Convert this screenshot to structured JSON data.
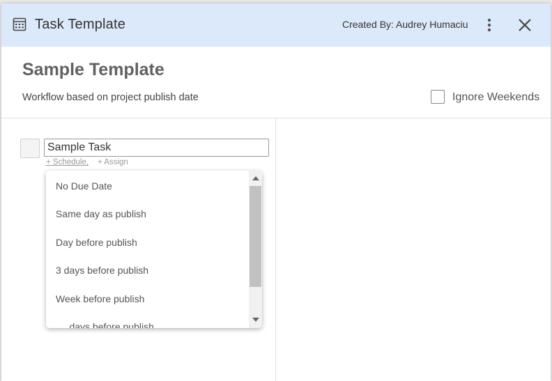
{
  "header": {
    "title": "Task Template",
    "created_by": "Created By: Audrey Humaciu",
    "icons": [
      "template-icon",
      "more-vertical-icon",
      "close-icon"
    ],
    "background": "#dce9fb"
  },
  "template": {
    "name": "Sample Template",
    "description": "Workflow based on project publish date",
    "ignore_weekends_label": "Ignore Weekends",
    "ignore_weekends_checked": false
  },
  "task": {
    "name_value": "Sample Task",
    "schedule_link": "+ Schedule,",
    "assign_link": "+ Assign"
  },
  "schedule_dropdown": {
    "options": [
      "No Due Date",
      "Same day as publish",
      "Day before publish",
      "3 days before publish",
      "Week before publish",
      "__ days before publish"
    ]
  }
}
